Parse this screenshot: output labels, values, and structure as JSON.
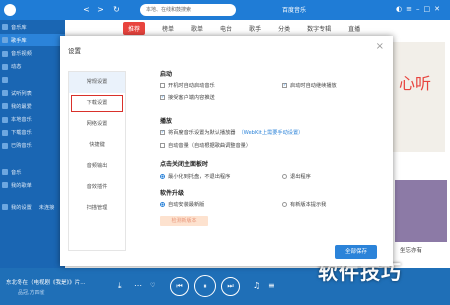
{
  "app": {
    "search_placeholder": "本地、在线和鼓搜索",
    "brand": "百度音乐",
    "tabs": [
      {
        "label": "推荐",
        "active": true
      },
      {
        "label": "榜单",
        "active": false
      },
      {
        "label": "歌单",
        "active": false
      },
      {
        "label": "电台",
        "active": false
      },
      {
        "label": "歌手",
        "active": false
      },
      {
        "label": "分类",
        "active": false
      },
      {
        "label": "数字专辑",
        "active": false
      },
      {
        "label": "直播",
        "active": false
      }
    ]
  },
  "sidebar": {
    "items": [
      {
        "label": "音乐库",
        "active": false
      },
      {
        "label": "歌手库",
        "active": true
      },
      {
        "label": "音乐视频",
        "active": false
      },
      {
        "label": "动态",
        "active": false
      },
      {
        "label": "",
        "active": false
      },
      {
        "label": "试听列表",
        "active": false
      },
      {
        "label": "我的最爱",
        "active": false
      },
      {
        "label": "本地音乐",
        "active": false
      },
      {
        "label": "下载音乐",
        "active": false
      },
      {
        "label": "已购音乐",
        "active": false
      }
    ],
    "section_heading": "",
    "sub_items": [
      {
        "label": "音乐",
        "active": false
      },
      {
        "label": "我的歌单",
        "active": false
      }
    ],
    "footer": [
      "我的设置",
      "未连接"
    ]
  },
  "background_page": {
    "banner_accent": "心听",
    "side_caption": "坐忘亦有",
    "bottom_caption": "坐忘亦有"
  },
  "settings_dialog": {
    "title": "设置",
    "nav": [
      {
        "label": "常规设置",
        "active": true,
        "highlighted": false
      },
      {
        "label": "下载设置",
        "active": false,
        "highlighted": true
      },
      {
        "label": "网络设置",
        "active": false,
        "highlighted": false
      },
      {
        "label": "快捷键",
        "active": false,
        "highlighted": false
      },
      {
        "label": "音频输出",
        "active": false,
        "highlighted": false
      },
      {
        "label": "音效插件",
        "active": false,
        "highlighted": false
      },
      {
        "label": "扫描管理",
        "active": false,
        "highlighted": false
      }
    ],
    "startup": {
      "heading": "启动",
      "autostart": {
        "label": "开机时自动启动音乐",
        "checked": false
      },
      "autoplay": {
        "label": "启动时自动继续播放",
        "checked": true
      },
      "push": {
        "label": "接受客户端内容推送",
        "checked": true
      }
    },
    "playback": {
      "heading": "播放",
      "default_player": {
        "label": "将百度音乐设置为默认播放器",
        "checked": true
      },
      "default_player_link": "（WebKit上需要手动设置）",
      "auto_volume": {
        "label": "自动音量（自动根据歌曲调整音量）",
        "checked": false
      }
    },
    "close_main": {
      "heading": "点击关闭主面板时",
      "minimize": {
        "label": "最小化到托盘，不退出程序",
        "selected": true
      },
      "exit": {
        "label": "退出程序",
        "selected": false
      }
    },
    "upgrade": {
      "heading": "软件升级",
      "auto": {
        "label": "自动安装最新版",
        "selected": true
      },
      "notify": {
        "label": "有新版本提示我",
        "selected": false
      },
      "check_button": "检测新版本"
    },
    "save_button": "全部保存"
  },
  "player": {
    "song": "东北冬在（电视剧《我是》》片...",
    "artist": "品冠,方四雀",
    "controls": {
      "prev": "⏮",
      "play_pause": "⏸",
      "next": "⏭"
    }
  },
  "watermark": "软件技巧"
}
